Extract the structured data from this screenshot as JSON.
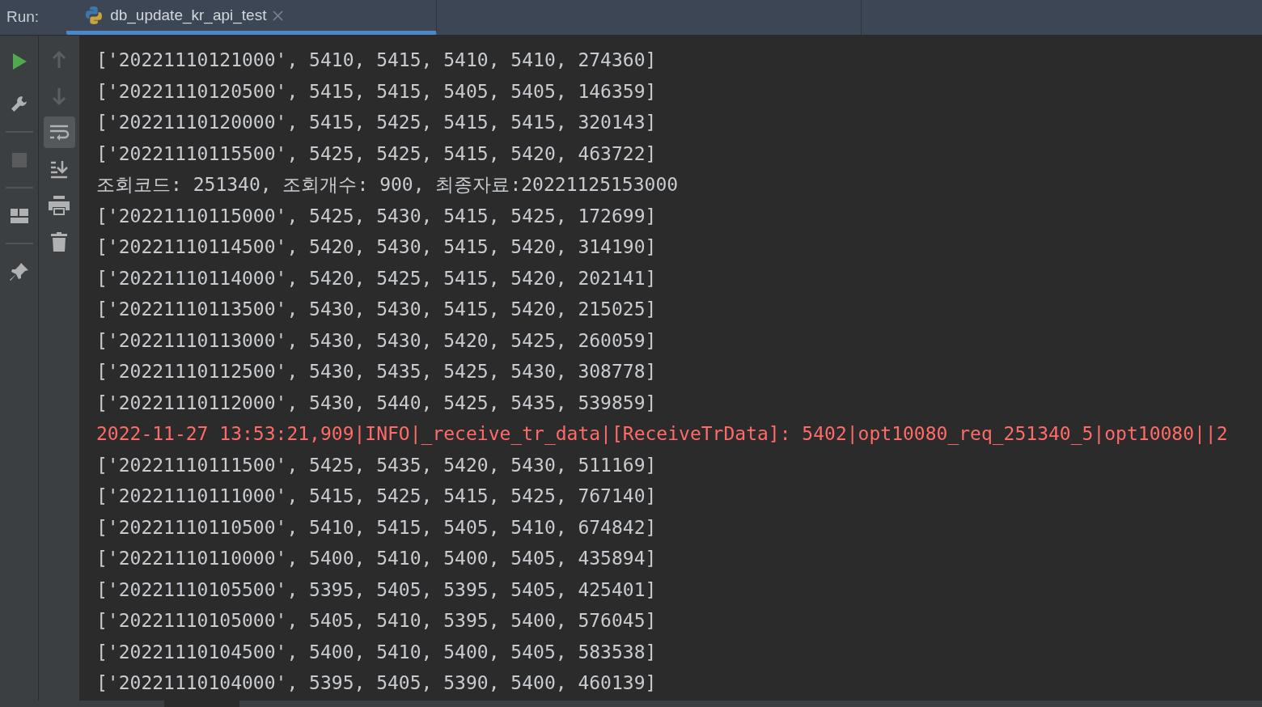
{
  "run_label": "Run:",
  "tab": {
    "title": "db_update_kr_api_test",
    "selected": true
  },
  "toolbar_left": [
    {
      "kind": "run"
    },
    {
      "kind": "wrench"
    },
    {
      "kind": "divider"
    },
    {
      "kind": "stop"
    },
    {
      "kind": "divider"
    },
    {
      "kind": "layout"
    },
    {
      "kind": "divider"
    },
    {
      "kind": "pin"
    }
  ],
  "toolbar_right": [
    {
      "kind": "up",
      "selected": false
    },
    {
      "kind": "down",
      "selected": false
    },
    {
      "kind": "wrap",
      "selected": true
    },
    {
      "kind": "scroll-end",
      "selected": false
    },
    {
      "kind": "print",
      "selected": false
    },
    {
      "kind": "trash",
      "selected": false
    }
  ],
  "lines": [
    {
      "kind": "out",
      "text": "['20221110121000', 5410, 5415, 5410, 5410, 274360]"
    },
    {
      "kind": "out",
      "text": "['20221110120500', 5415, 5415, 5405, 5405, 146359]"
    },
    {
      "kind": "out",
      "text": "['20221110120000', 5415, 5425, 5415, 5415, 320143]"
    },
    {
      "kind": "out",
      "text": "['20221110115500', 5425, 5425, 5415, 5420, 463722]"
    },
    {
      "kind": "out",
      "text": "조회코드: 251340, 조회개수: 900, 최종자료:20221125153000"
    },
    {
      "kind": "out",
      "text": "['20221110115000', 5425, 5430, 5415, 5425, 172699]"
    },
    {
      "kind": "out",
      "text": "['20221110114500', 5420, 5430, 5415, 5420, 314190]"
    },
    {
      "kind": "out",
      "text": "['20221110114000', 5420, 5425, 5415, 5420, 202141]"
    },
    {
      "kind": "out",
      "text": "['20221110113500', 5430, 5430, 5415, 5420, 215025]"
    },
    {
      "kind": "out",
      "text": "['20221110113000', 5430, 5430, 5420, 5425, 260059]"
    },
    {
      "kind": "out",
      "text": "['20221110112500', 5430, 5435, 5425, 5430, 308778]"
    },
    {
      "kind": "out",
      "text": "['20221110112000', 5430, 5440, 5425, 5435, 539859]"
    },
    {
      "kind": "err",
      "text": "2022-11-27 13:53:21,909|INFO|_receive_tr_data|[ReceiveTrData]: 5402|opt10080_req_251340_5|opt10080||2"
    },
    {
      "kind": "out",
      "text": "['20221110111500', 5425, 5435, 5420, 5430, 511169]"
    },
    {
      "kind": "out",
      "text": "['20221110111000', 5415, 5425, 5415, 5425, 767140]"
    },
    {
      "kind": "out",
      "text": "['20221110110500', 5410, 5415, 5405, 5410, 674842]"
    },
    {
      "kind": "out",
      "text": "['20221110110000', 5400, 5410, 5400, 5405, 435894]"
    },
    {
      "kind": "out",
      "text": "['20221110105500', 5395, 5405, 5395, 5405, 425401]"
    },
    {
      "kind": "out",
      "text": "['20221110105000', 5405, 5410, 5395, 5400, 576045]"
    },
    {
      "kind": "out",
      "text": "['20221110104500', 5400, 5410, 5400, 5405, 583538]"
    },
    {
      "kind": "out",
      "text": "['20221110104000', 5395, 5405, 5390, 5400, 460139]"
    }
  ]
}
